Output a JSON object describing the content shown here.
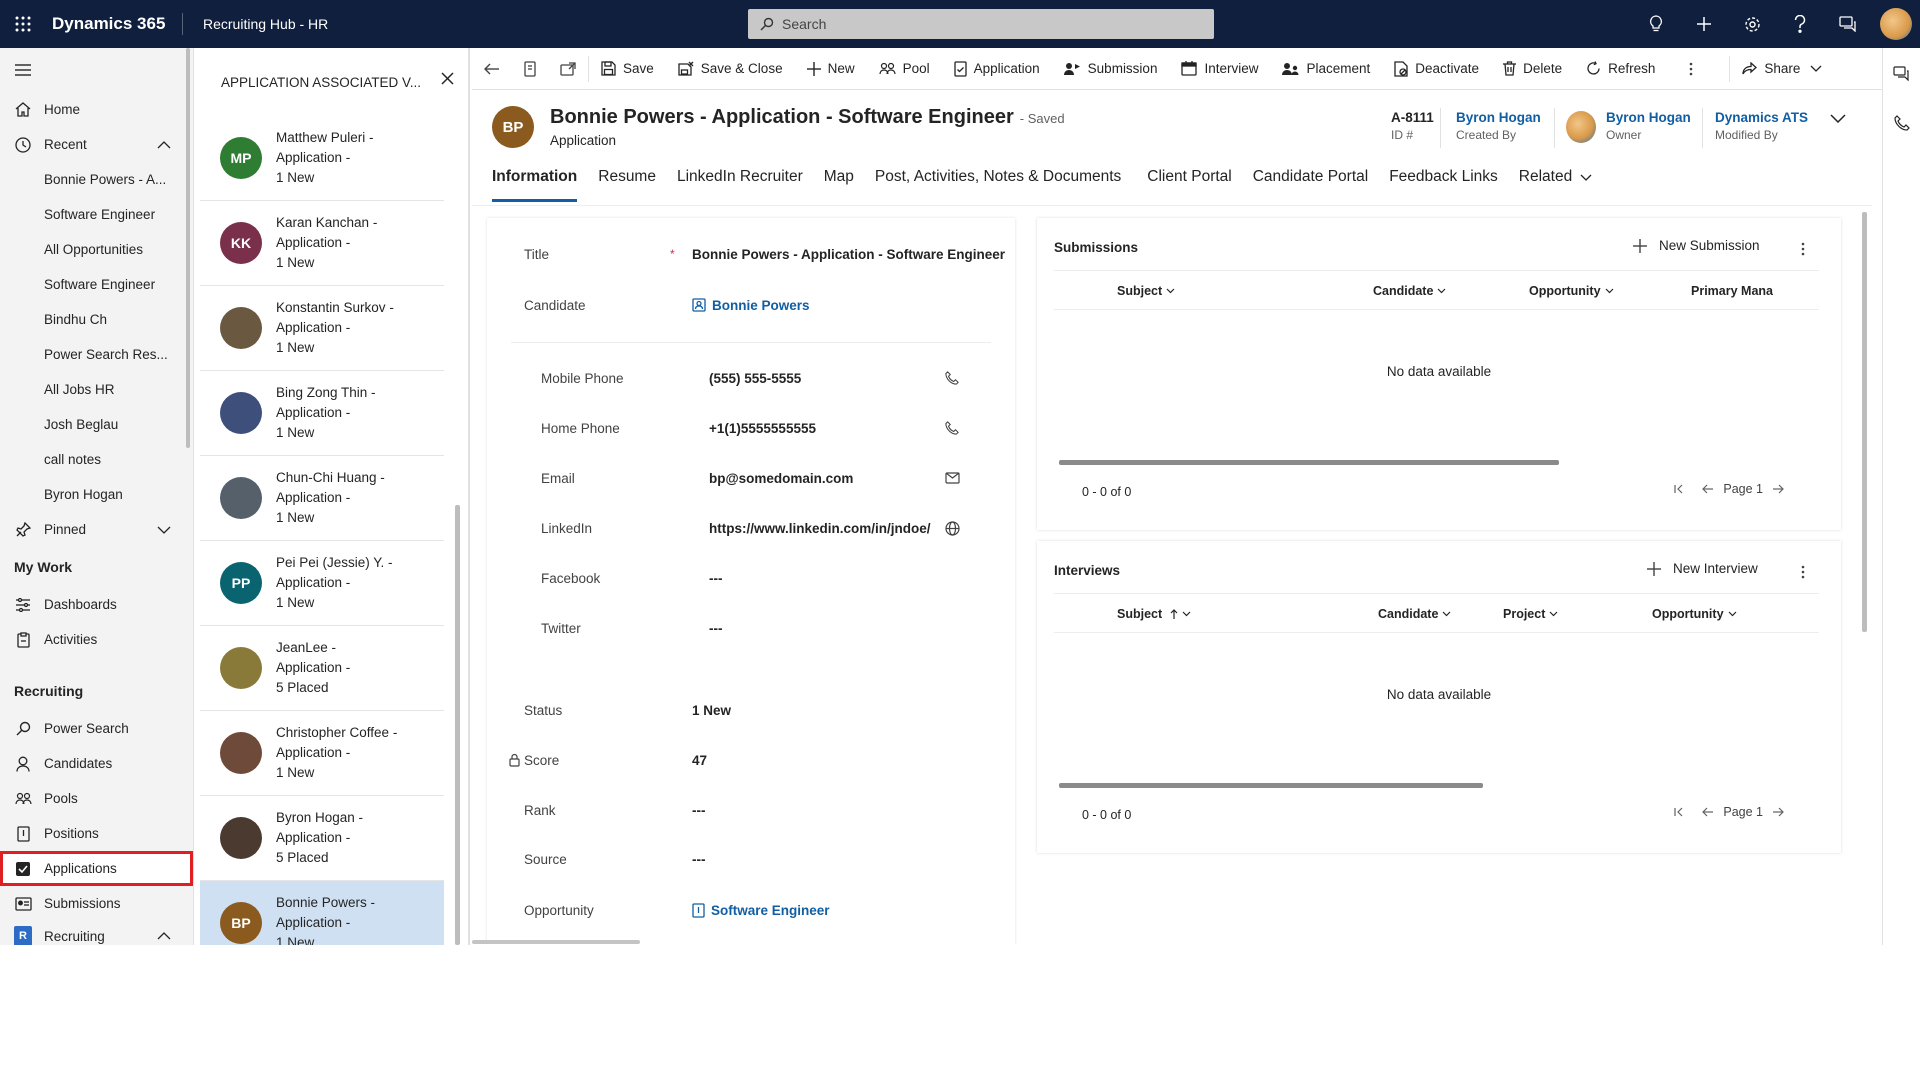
{
  "topbar": {
    "brand": "Dynamics 365",
    "app_title": "Recruiting Hub - HR",
    "search_placeholder": "Search"
  },
  "leftnav": {
    "home": "Home",
    "recent": "Recent",
    "recent_items": [
      "Bonnie Powers - A...",
      "Software Engineer",
      "All Opportunities",
      "Software Engineer",
      "Bindhu Ch",
      "Power Search Res...",
      "All Jobs HR",
      "Josh Beglau",
      "call notes",
      "Byron Hogan"
    ],
    "pinned": "Pinned",
    "my_work": "My Work",
    "dashboards": "Dashboards",
    "activities": "Activities",
    "recruiting_header": "Recruiting",
    "power_search": "Power Search",
    "candidates": "Candidates",
    "pools": "Pools",
    "positions": "Positions",
    "applications": "Applications",
    "submissions": "Submissions",
    "area_switcher": "Recruiting",
    "area_badge": "R"
  },
  "assoc": {
    "title": "APPLICATION ASSOCIATED V...",
    "items": [
      {
        "line1": "Matthew Puleri -",
        "line2": "Application -",
        "line3": "1 New",
        "initials": "MP",
        "color": "#2e7d32"
      },
      {
        "line1": "Karan Kanchan -",
        "line2": "Application -",
        "line3": "1 New",
        "initials": "KK",
        "color": "#7a2f4a"
      },
      {
        "line1": "Konstantin Surkov -",
        "line2": "Application -",
        "line3": "1 New",
        "initials": "",
        "color": "#6b5840"
      },
      {
        "line1": "Bing Zong Thin -",
        "line2": "Application -",
        "line3": "1 New",
        "initials": "",
        "color": "#3d4f7a"
      },
      {
        "line1": "Chun-Chi Huang -",
        "line2": "Application -",
        "line3": "1 New",
        "initials": "",
        "color": "#55606a"
      },
      {
        "line1": "Pei Pei (Jessie) Y. -",
        "line2": "Application -",
        "line3": "1 New",
        "initials": "PP",
        "color": "#0a6470"
      },
      {
        "line1": "JeanLee -",
        "line2": "Application -",
        "line3": "5 Placed",
        "initials": "",
        "color": "#8a7a3a"
      },
      {
        "line1": "Christopher Coffee -",
        "line2": "Application -",
        "line3": "1 New",
        "initials": "",
        "color": "#6e4a3a"
      },
      {
        "line1": "Byron Hogan -",
        "line2": "Application -",
        "line3": "5 Placed",
        "initials": "",
        "color": "#4a3a30"
      },
      {
        "line1": "Bonnie Powers -",
        "line2": "Application -",
        "line3": "1 New",
        "initials": "BP",
        "color": "#8a5a1e"
      }
    ]
  },
  "cmdbar": {
    "save": "Save",
    "save_close": "Save & Close",
    "new": "New",
    "pool": "Pool",
    "application": "Application",
    "submission": "Submission",
    "interview": "Interview",
    "placement": "Placement",
    "deactivate": "Deactivate",
    "delete": "Delete",
    "refresh": "Refresh",
    "share": "Share"
  },
  "record": {
    "initials": "BP",
    "title": "Bonnie Powers - Application - Software Engineer",
    "saved": "- Saved",
    "entity": "Application",
    "id_value": "A-8111",
    "id_label": "ID #",
    "created_by_value": "Byron Hogan",
    "created_by_label": "Created By",
    "owner_value": "Byron Hogan",
    "owner_label": "Owner",
    "modified_by_value": "Dynamics ATS",
    "modified_by_label": "Modified By"
  },
  "tabs": [
    "Information",
    "Resume",
    "LinkedIn Recruiter",
    "Map",
    "Post, Activities, Notes & Documents",
    "Client Portal",
    "Candidate Portal",
    "Feedback Links",
    "Related"
  ],
  "form": {
    "title_label": "Title",
    "title_value": "Bonnie Powers - Application - Software Engineer",
    "candidate_label": "Candidate",
    "candidate_value": "Bonnie Powers",
    "mobile_label": "Mobile Phone",
    "mobile_value": "(555) 555-5555",
    "home_label": "Home Phone",
    "home_value": "+1(1)5555555555",
    "email_label": "Email",
    "email_value": "bp@somedomain.com",
    "linkedin_label": "LinkedIn",
    "linkedin_value": "https://www.linkedin.com/in/jndoe/",
    "facebook_label": "Facebook",
    "facebook_value": "---",
    "twitter_label": "Twitter",
    "twitter_value": "---",
    "status_label": "Status",
    "status_value": "1 New",
    "score_label": "Score",
    "score_value": "47",
    "rank_label": "Rank",
    "rank_value": "---",
    "source_label": "Source",
    "source_value": "---",
    "opportunity_label": "Opportunity",
    "opportunity_value": "Software Engineer"
  },
  "submissions": {
    "title": "Submissions",
    "new_label": "New Submission",
    "columns": [
      "Subject",
      "Candidate",
      "Opportunity",
      "Primary Mana"
    ],
    "empty": "No data available",
    "count": "0 - 0 of 0",
    "page": "Page 1"
  },
  "interviews": {
    "title": "Interviews",
    "new_label": "New Interview",
    "columns": [
      "Subject",
      "Candidate",
      "Project",
      "Opportunity"
    ],
    "empty": "No data available",
    "count": "0 - 0 of 0",
    "page": "Page 1"
  },
  "colors": {
    "topbar": "#0f1f3d",
    "accent": "#115ea3",
    "selected_row": "#cfe0f3",
    "highlight_box": "#e02020"
  }
}
